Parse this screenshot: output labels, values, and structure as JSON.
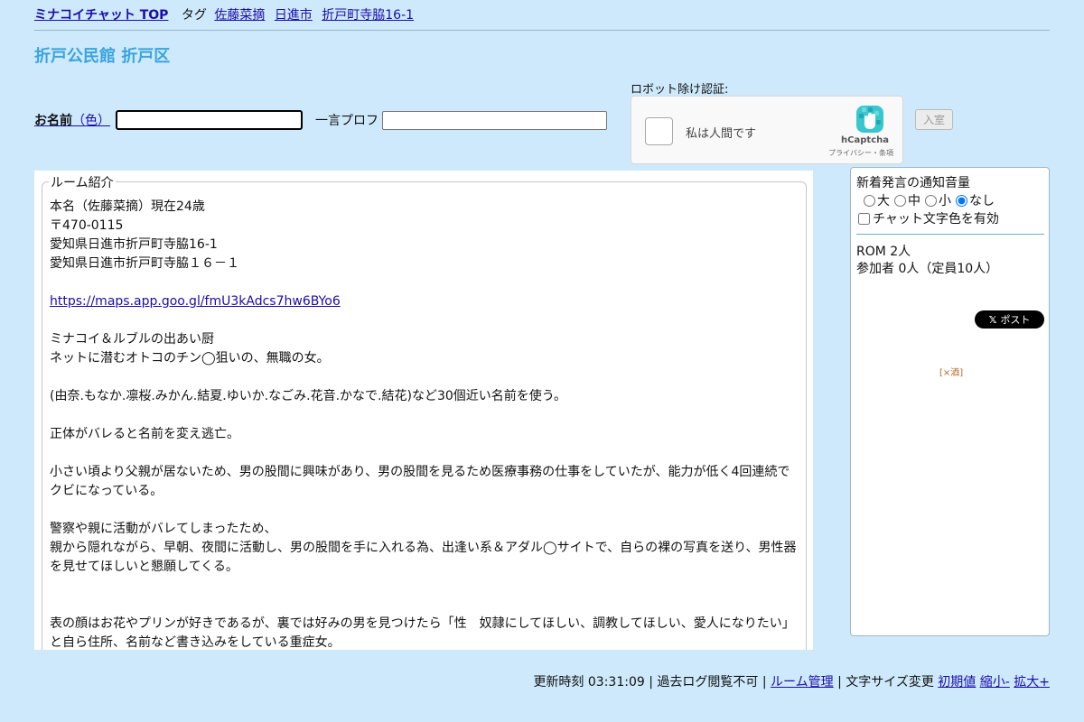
{
  "topnav": {
    "home_label": "ミナコイチャット TOP",
    "tag_label": "タグ",
    "tags": [
      "佐藤菜摘",
      "日進市",
      "折戸町寺脇16-1"
    ]
  },
  "room": {
    "title": "折戸公民館 折戸区"
  },
  "entry": {
    "name_label_bold": "お名前",
    "name_label_suffix": "（色）",
    "name_value": "",
    "prof_label": "一言プロフ",
    "prof_value": "",
    "enter_label": "入室"
  },
  "captcha": {
    "label": "ロボット除け認証:",
    "checkbox_text": "私は人間です",
    "brand": "hCaptcha",
    "links": "プライバシー・条項"
  },
  "intro": {
    "legend": "ルーム紹介",
    "lines": [
      "本名（佐藤菜摘）現在24歳",
      "〒470-0115",
      "愛知県日進市折戸町寺脇16-1",
      "愛知県日進市折戸町寺脇１６－１",
      "",
      "https://maps.app.goo.gl/fmU3kAdcs7hw6BYo6",
      "",
      "ミナコイ＆ルブルの出あい厨",
      "ネットに潜むオトコのチン◯狙いの、無職の女。",
      "",
      "(由奈.もなか.凛桜.みかん.結夏.ゆいか.なごみ.花音.かなで.結花)など30個近い名前を使う。",
      "",
      "正体がバレると名前を変え逃亡。",
      "",
      "小さい頃より父親が居ないため、男の股間に興味があり、男の股間を見るため医療事務の仕事をしていたが、能力が低く4回連続でクビになっている。",
      "",
      "警察や親に活動がバレてしまったため、",
      "親から隠れながら、早朝、夜間に活動し、男の股間を手に入れる為、出逢い系＆アダル◯サイトで、自らの裸の写真を送り、男性器を見せてほしいと懇願してくる。",
      "",
      "",
      "表の顔はお花やプリンが好きであるが、裏では好みの男を見つけたら「性　奴隷にしてほしい、調教してほしい、愛人になりたい」と自ら住所、名前など書き込みをしている重症女。"
    ]
  },
  "sidebar": {
    "volume_title": "新着発言の通知音量",
    "volume_options": [
      "大",
      "中",
      "小",
      "なし"
    ],
    "volume_selected": "なし",
    "color_option_label": "チャット文字色を有効",
    "color_option_checked": false,
    "rom_label": "ROM 2人",
    "members_label": "参加者 0人（定員10人）",
    "x_post_label": "ポスト",
    "ad_label": "[×酒]"
  },
  "footer": {
    "updated_label": "更新時刻",
    "updated_time": "03:31:09",
    "sep": "|",
    "log_status": "過去ログ閲覧不可",
    "room_admin_label": "ルーム管理",
    "font_size_label": "文字サイズ変更",
    "reset_label": "初期値",
    "shrink_label": "縮小-",
    "enlarge_label": "拡大+"
  },
  "colors": {
    "background": "#cde9fb",
    "title": "#3aa4df",
    "link": "#1a0dab",
    "divider": "#6fb1c6"
  }
}
